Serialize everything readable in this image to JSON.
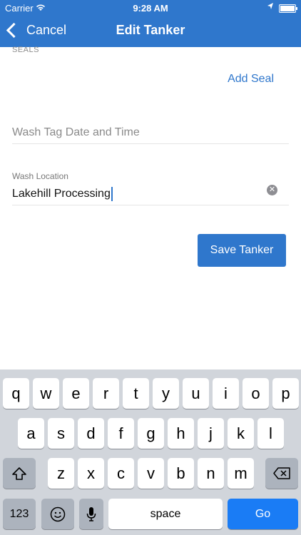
{
  "status_bar": {
    "carrier": "Carrier",
    "time": "9:28 AM"
  },
  "nav": {
    "back_label": "Cancel",
    "title": "Edit Tanker"
  },
  "form": {
    "seals_section_label": "SEALS",
    "add_seal_label": "Add Seal",
    "wash_tag_placeholder": "Wash Tag Date and Time",
    "wash_location_label": "Wash Location",
    "wash_location_value": "Lakehill Processing",
    "save_button_label": "Save Tanker"
  },
  "keyboard": {
    "row1": [
      "q",
      "w",
      "e",
      "r",
      "t",
      "y",
      "u",
      "i",
      "o",
      "p"
    ],
    "row2": [
      "a",
      "s",
      "d",
      "f",
      "g",
      "h",
      "j",
      "k",
      "l"
    ],
    "row3": [
      "z",
      "x",
      "c",
      "v",
      "b",
      "n",
      "m"
    ],
    "numbers_label": "123",
    "space_label": "space",
    "go_label": "Go"
  },
  "colors": {
    "accent": "#2f77cc",
    "go_key": "#1a7cf5"
  }
}
